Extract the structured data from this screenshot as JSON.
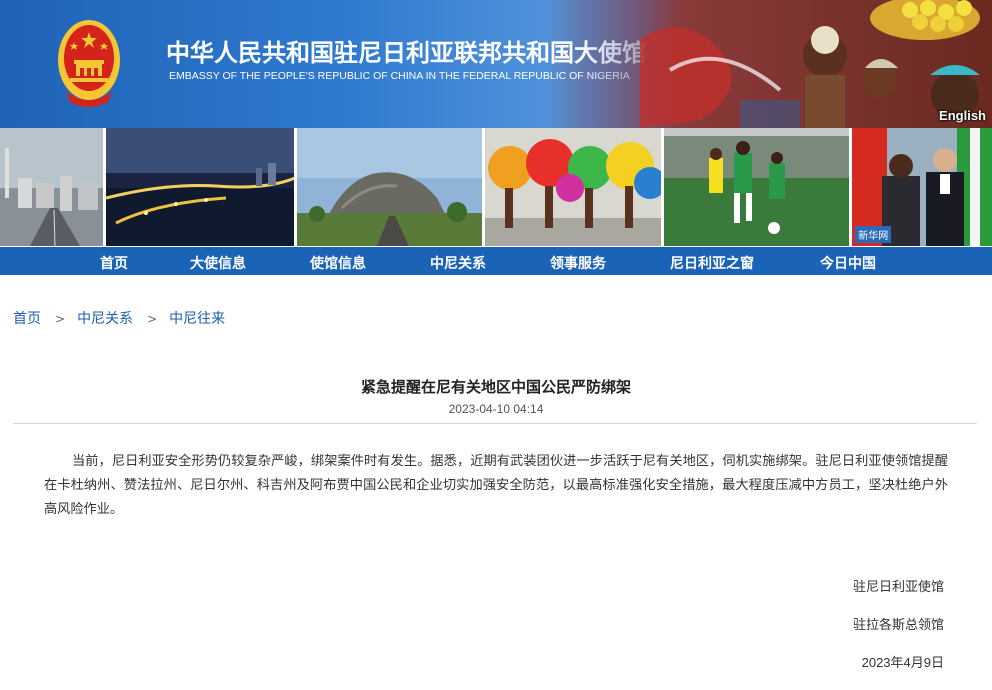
{
  "header": {
    "title_cn": "中华人民共和国驻尼日利亚联邦共和国大使馆",
    "title_en": "EMBASSY OF THE PEOPLE'S REPUBLIC OF CHINA IN THE FEDERAL REPUBLIC OF NIGERIA",
    "language_link": "English"
  },
  "photos": {
    "xinhua_badge": "新华网"
  },
  "nav": {
    "items": [
      "首页",
      "大使信息",
      "使馆信息",
      "中尼关系",
      "领事服务",
      "尼日利亚之窗",
      "今日中国"
    ]
  },
  "breadcrumb": {
    "items": [
      "首页",
      "中尼关系",
      "中尼往来"
    ],
    "separator": ">"
  },
  "article": {
    "title": "紧急提醒在尼有关地区中国公民严防绑架",
    "date": "2023-04-10 04:14",
    "body": "当前，尼日利亚安全形势仍较复杂严峻，绑架案件时有发生。据悉，近期有武装团伙进一步活跃于尼有关地区，伺机实施绑架。驻尼日利亚使领馆提醒在卡杜纳州、赞法拉州、尼日尔州、科吉州及阿布贾中国公民和企业切实加强安全防范，以最高标准强化安全措施，最大程度压减中方员工，坚决杜绝户外高风险作业。",
    "signatures": [
      "驻尼日利亚使馆",
      "驻拉各斯总领馆",
      "2023年4月9日"
    ]
  },
  "colors": {
    "nav_bg": "#1b63b7",
    "banner_blue": "#2f7ad0",
    "link": "#1b5fae",
    "emblem_red": "#d4231b",
    "emblem_gold": "#f6c634"
  }
}
